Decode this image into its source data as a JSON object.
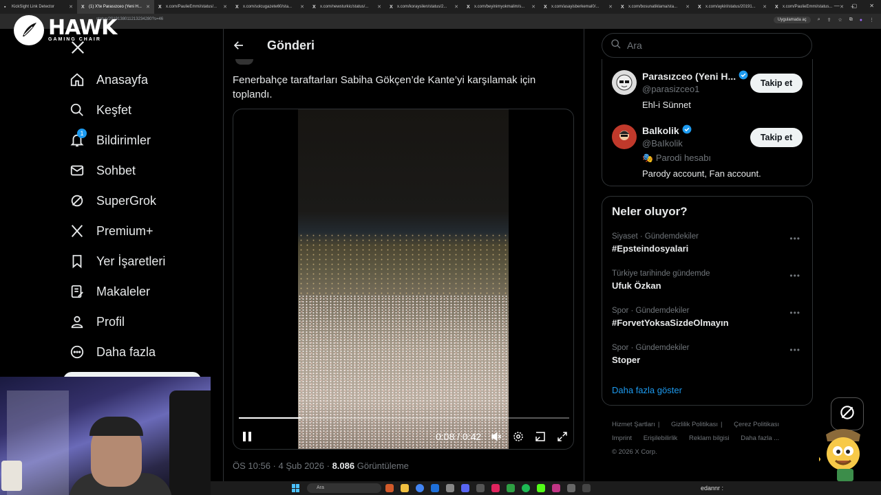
{
  "browser": {
    "tabs": [
      {
        "title": "KickSight Link Detector",
        "active": false
      },
      {
        "title": "(1) X'te Parasızceo (Yeni H...",
        "active": true
      },
      {
        "title": "x.com/PaulieEmmi/status/...",
        "active": false
      },
      {
        "title": "x.com/solcugazete60/sta...",
        "active": false
      },
      {
        "title": "x.com/newsturkic/status/...",
        "active": false
      },
      {
        "title": "x.com/koraysilen/status/2...",
        "active": false
      },
      {
        "title": "x.com/beyinimyokmalim/s...",
        "active": false
      },
      {
        "title": "x.com/asayisberkemal0/...",
        "active": false
      },
      {
        "title": "x.com/bosunatiklama/sta...",
        "active": false
      },
      {
        "title": "x.com/aykiri/status/20191...",
        "active": false
      },
      {
        "title": "x.com/PaulieEmmi/status...",
        "active": false
      }
    ],
    "url": "status/2019138011213234280?s=46",
    "open_in_app": "Uygulamada aç"
  },
  "logo": {
    "name": "HAWK",
    "sub": "GAMING CHAIR"
  },
  "nav": {
    "items": [
      {
        "label": "Anasayfa",
        "icon": "home-icon"
      },
      {
        "label": "Keşfet",
        "icon": "search-icon"
      },
      {
        "label": "Bildirimler",
        "icon": "bell-icon"
      },
      {
        "label": "Sohbet",
        "icon": "mail-icon"
      },
      {
        "label": "SuperGrok",
        "icon": "grok-icon"
      },
      {
        "label": "Premium+",
        "icon": "x-logo-icon"
      },
      {
        "label": "Yer İşaretleri",
        "icon": "bookmark-icon"
      },
      {
        "label": "Makaleler",
        "icon": "article-icon"
      },
      {
        "label": "Profil",
        "icon": "person-icon"
      },
      {
        "label": "Daha fazla",
        "icon": "more-circle-icon"
      }
    ],
    "notification_count": "1"
  },
  "post": {
    "header_title": "Gönderi",
    "text": "Fenerbahçe taraftarları Sabiha Gökçen’de Kante’yi karşılamak için toplandı.",
    "video": {
      "time": "0:08 / 0:42",
      "progress": 0.19
    },
    "time": "ÖS 10:56",
    "date": "4 Şub 2026",
    "views": "8.086",
    "views_label": "Görüntüleme"
  },
  "search": {
    "placeholder": "Ara"
  },
  "follow": [
    {
      "name": "Parasızceo (Yeni H...",
      "handle": "@parasizceo1",
      "bio": "Ehl-i Sünnet",
      "label": "",
      "button": "Takip et"
    },
    {
      "name": "Balkolik",
      "handle": "@BaIkolik",
      "label": "Parodi hesabı",
      "bio": "Parody account, Fan account.",
      "button": "Takip et"
    }
  ],
  "trends": {
    "title": "Neler oluyor?",
    "items": [
      {
        "category": "Siyaset · Gündemdekiler",
        "name": "#Epsteindosyalari"
      },
      {
        "category": "Türkiye tarihinde gündemde",
        "name": "Ufuk Özkan"
      },
      {
        "category": "Spor · Gündemdekiler",
        "name": "#ForvetYoksaSizdeOlmayın"
      },
      {
        "category": "Spor · Gündemdekiler",
        "name": "Stoper"
      }
    ],
    "show_more": "Daha fazla göster"
  },
  "footer": {
    "links": [
      "Hizmet Şartları",
      "Gizlilik Politikası",
      "Çerez Politikası",
      "Imprint",
      "Erişilebilirlik",
      "Reklam bilgisi",
      "Daha fazla ..."
    ],
    "copyright": "© 2026 X Corp."
  },
  "taskbar": {
    "search": "Ara",
    "user": "edannr :"
  },
  "colors": {
    "accent": "#1d9bf0",
    "bg": "#000000",
    "border": "#2f3336",
    "muted": "#71767b"
  }
}
